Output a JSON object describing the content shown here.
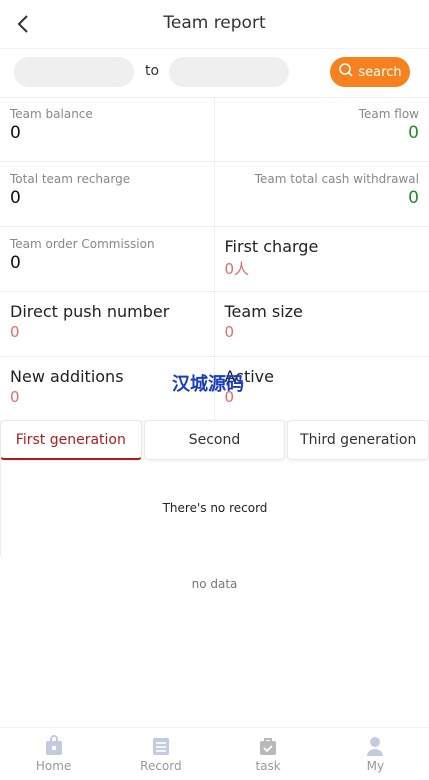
{
  "header": {
    "title": "Team report"
  },
  "filter": {
    "start_placeholder": "",
    "to_label": "to",
    "end_placeholder": "",
    "search_label": "search"
  },
  "stats": {
    "team_balance": {
      "label": "Team balance",
      "value": "0"
    },
    "team_flow": {
      "label": "Team flow",
      "value": "0"
    },
    "total_recharge": {
      "label": "Total team recharge",
      "value": "0"
    },
    "total_withdrawal": {
      "label": "Team total cash withdrawal",
      "value": "0"
    },
    "order_commission": {
      "label": "Team order Commission",
      "value": "0"
    },
    "first_charge": {
      "label": "First charge",
      "value": "0人"
    },
    "direct_push": {
      "label": "Direct push number",
      "value": "0"
    },
    "team_size": {
      "label": "Team size",
      "value": "0"
    },
    "new_additions": {
      "label": "New additions",
      "value": "0"
    },
    "active": {
      "label": "Active",
      "value": "0"
    }
  },
  "watermark": "汉城源码",
  "tabs": [
    {
      "label": "First generation"
    },
    {
      "label": "Second"
    },
    {
      "label": "Third generation"
    }
  ],
  "records": {
    "empty_text": "There's no record"
  },
  "no_data": "no data",
  "nav": [
    {
      "label": "Home",
      "icon": "home-icon"
    },
    {
      "label": "Record",
      "icon": "record-icon"
    },
    {
      "label": "task",
      "icon": "task-icon"
    },
    {
      "label": "My",
      "icon": "user-icon"
    }
  ],
  "colors": {
    "accent": "#f5821f",
    "active_tab": "#b21c1c",
    "positive": "#2a8a2a",
    "negative": "#e56b6b",
    "watermark": "#1a3cc0"
  }
}
